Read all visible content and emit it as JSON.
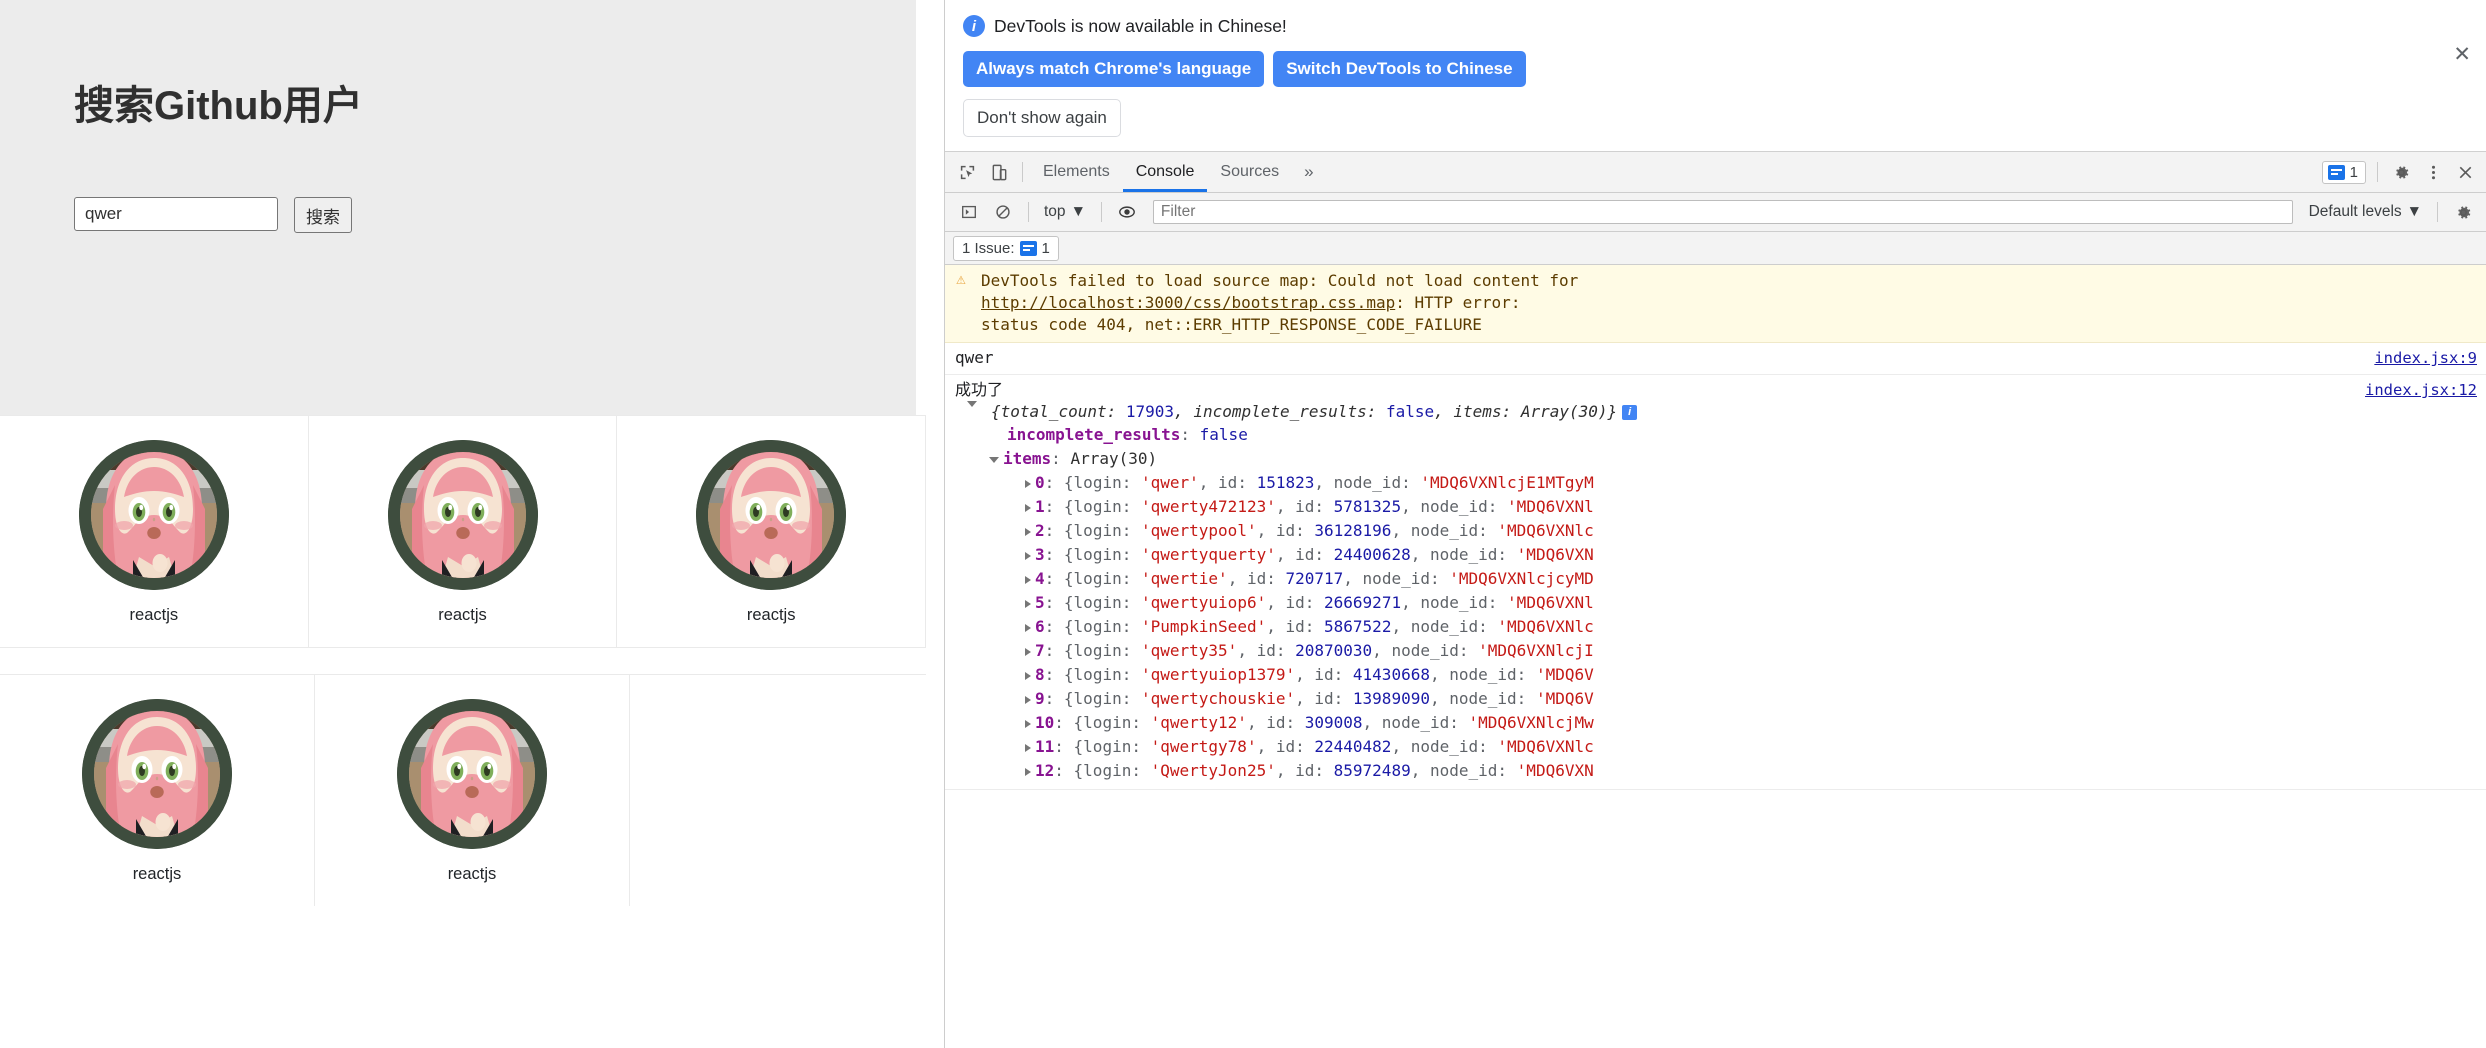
{
  "page": {
    "title": "搜索Github用户",
    "search": {
      "value": "qwer",
      "placeholder": ""
    },
    "search_button": "搜索",
    "cards": [
      {
        "label": "reactjs"
      },
      {
        "label": "reactjs"
      },
      {
        "label": "reactjs"
      },
      {
        "label": "reactjs"
      },
      {
        "label": "reactjs"
      }
    ]
  },
  "devtools": {
    "language_banner": {
      "message": "DevTools is now available in Chinese!",
      "primary_button": "Always match Chrome's language",
      "secondary_button": "Switch DevTools to Chinese",
      "dismiss_button": "Don't show again",
      "close": "✕"
    },
    "tabs": [
      {
        "label": "Elements",
        "active": false
      },
      {
        "label": "Console",
        "active": true
      },
      {
        "label": "Sources",
        "active": false
      }
    ],
    "more_tabs": "»",
    "issues_badge_count": "1",
    "toolbar": {
      "context": "top",
      "context_caret": "▼",
      "filter_placeholder": "Filter",
      "levels": "Default levels",
      "levels_caret": "▼"
    },
    "issues_bar": {
      "label": "1 Issue:",
      "count": "1"
    },
    "console": {
      "warning": {
        "line1": "DevTools failed to load source map: Could not load content for",
        "url": "http://localhost:3000/css/bootstrap.css.map",
        "line2_suffix": ": HTTP error:",
        "line3": "status code 404, net::ERR_HTTP_RESPONSE_CODE_FAILURE"
      },
      "log1": {
        "text": "qwer",
        "source": "index.jsx:9"
      },
      "log2": {
        "text": "成功了",
        "source": "index.jsx:12"
      },
      "object": {
        "source": "index.jsx:12",
        "preview_parts": {
          "open": "{",
          "k1": "total_count: ",
          "v1": "17903",
          "k2": ", incomplete_results: ",
          "v2": "false",
          "k3": ", items: Array",
          "v3": "(30)}"
        },
        "children": [
          {
            "key": "incomplete_results",
            "value": "false",
            "value_kind": "kw"
          },
          {
            "key": "items",
            "value": "Array(30)",
            "value_kind": "plain"
          }
        ],
        "items": [
          {
            "index": "0",
            "login": "qwer",
            "id": "151823",
            "node_id": "MDQ6VXNlcjE1MTgyM"
          },
          {
            "index": "1",
            "login": "qwerty472123",
            "id": "5781325",
            "node_id": "MDQ6VXNl"
          },
          {
            "index": "2",
            "login": "qwertypool",
            "id": "36128196",
            "node_id": "MDQ6VXNlc"
          },
          {
            "index": "3",
            "login": "qwertyquerty",
            "id": "24400628",
            "node_id": "MDQ6VXN"
          },
          {
            "index": "4",
            "login": "qwertie",
            "id": "720717",
            "node_id": "MDQ6VXNlcjcyMD"
          },
          {
            "index": "5",
            "login": "qwertyuiop6",
            "id": "26669271",
            "node_id": "MDQ6VXNl"
          },
          {
            "index": "6",
            "login": "PumpkinSeed",
            "id": "5867522",
            "node_id": "MDQ6VXNlc"
          },
          {
            "index": "7",
            "login": "qwerty35",
            "id": "20870030",
            "node_id": "MDQ6VXNlcjI"
          },
          {
            "index": "8",
            "login": "qwertyuiop1379",
            "id": "41430668",
            "node_id": "MDQ6V"
          },
          {
            "index": "9",
            "login": "qwertychouskie",
            "id": "13989090",
            "node_id": "MDQ6V"
          },
          {
            "index": "10",
            "login": "qwerty12",
            "id": "309008",
            "node_id": "MDQ6VXNlcjMw"
          },
          {
            "index": "11",
            "login": "qwertgy78",
            "id": "22440482",
            "node_id": "MDQ6VXNlc"
          },
          {
            "index": "12",
            "login": "QwertyJon25",
            "id": "85972489",
            "node_id": "MDQ6VXN"
          }
        ],
        "item_tokens": {
          "brace": "{",
          "login_key": "login: ",
          "id_key": ", id: ",
          "node_key": ", node_id: ",
          "quote": "'",
          "colon": ": "
        }
      }
    }
  },
  "colors": {
    "accent_blue": "#4285f4",
    "tab_active": "#1a73e8",
    "warning_bg": "#fffbe5",
    "jumbotron_bg": "#ececec",
    "string_red": "#c41a16",
    "number_blue": "#1a1aa6",
    "prop_purple": "#881391"
  }
}
